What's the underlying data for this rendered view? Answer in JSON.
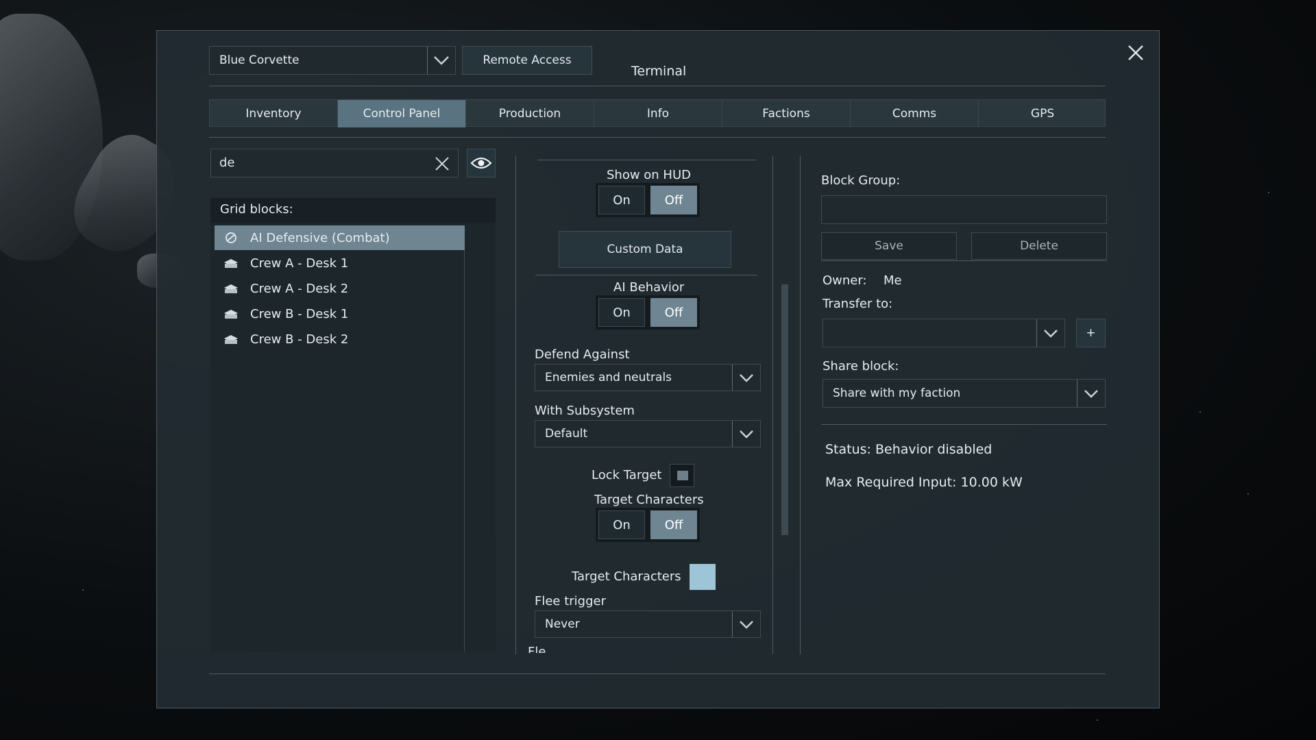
{
  "window": {
    "title": "Terminal",
    "close_icon": "close-icon"
  },
  "grid_select": {
    "value": "Blue Corvette"
  },
  "remote_access": {
    "label": "Remote Access"
  },
  "tabs": [
    {
      "label": "Inventory"
    },
    {
      "label": "Control Panel"
    },
    {
      "label": "Production"
    },
    {
      "label": "Info"
    },
    {
      "label": "Factions"
    },
    {
      "label": "Comms"
    },
    {
      "label": "GPS"
    }
  ],
  "active_tab": "Control Panel",
  "search": {
    "value": "de"
  },
  "grid_blocks": {
    "title": "Grid blocks:",
    "items": [
      {
        "label": "AI Defensive (Combat)",
        "icon": "ai-block-icon",
        "selected": true
      },
      {
        "label": "Crew A - Desk 1",
        "icon": "desk-icon"
      },
      {
        "label": "Crew A - Desk 2",
        "icon": "desk-icon"
      },
      {
        "label": "Crew B - Desk 1",
        "icon": "desk-icon"
      },
      {
        "label": "Crew B - Desk 2",
        "icon": "desk-icon"
      }
    ]
  },
  "controls": {
    "show_on_hud": {
      "label": "Show on HUD",
      "on": "On",
      "off": "Off",
      "value": "Off"
    },
    "custom_data": {
      "label": "Custom Data"
    },
    "ai_behavior": {
      "label": "AI Behavior",
      "on": "On",
      "off": "Off",
      "value": "Off"
    },
    "defend_against": {
      "label": "Defend Against",
      "value": "Enemies and neutrals"
    },
    "with_subsystem": {
      "label": "With Subsystem",
      "value": "Default"
    },
    "lock_target": {
      "label": "Lock Target",
      "checked": false
    },
    "target_characters_toggle": {
      "label": "Target Characters",
      "on": "On",
      "off": "Off",
      "value": "Off"
    },
    "target_characters_check": {
      "label": "Target Characters",
      "checked": true
    },
    "flee_trigger": {
      "label": "Flee trigger",
      "value": "Never"
    },
    "cut_off_label": "Fle..."
  },
  "right_panel": {
    "block_group_label": "Block Group:",
    "block_group_value": "",
    "save_label": "Save",
    "delete_label": "Delete",
    "owner_label": "Owner:",
    "owner_value": "Me",
    "transfer_label": "Transfer to:",
    "transfer_value": "",
    "add_label": "+",
    "share_label": "Share block:",
    "share_value": "Share with my faction",
    "status": "Status: Behavior disabled",
    "max_input": "Max Required Input: 10.00 kW"
  },
  "colors": {
    "accent": "#6f8592",
    "panel": "#222c32",
    "checkbox_on": "#9ec4d8"
  }
}
